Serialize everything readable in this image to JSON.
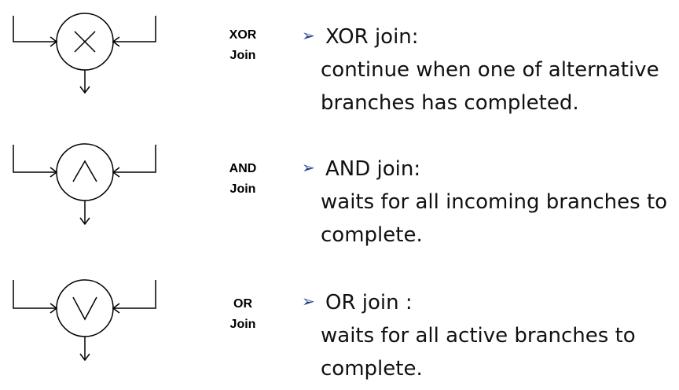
{
  "gateways": [
    {
      "symbol": "x-cross-icon",
      "tag_line1": "XOR",
      "tag_line2": "Join",
      "heading": "XOR join:",
      "line1": "continue when one of alternative",
      "line2": "branches has completed."
    },
    {
      "symbol": "and-wedge-icon",
      "tag_line1": "AND",
      "tag_line2": "Join",
      "heading": "AND join:",
      "line1": "waits for all incoming branches to",
      "line2": "complete."
    },
    {
      "symbol": "or-vee-icon",
      "tag_line1": "OR",
      "tag_line2": "Join",
      "heading": "OR join :",
      "line1": "waits for all active branches to",
      "line2": "complete."
    }
  ],
  "colors": {
    "bullet": "#1e3f8a",
    "stroke": "#000000"
  }
}
